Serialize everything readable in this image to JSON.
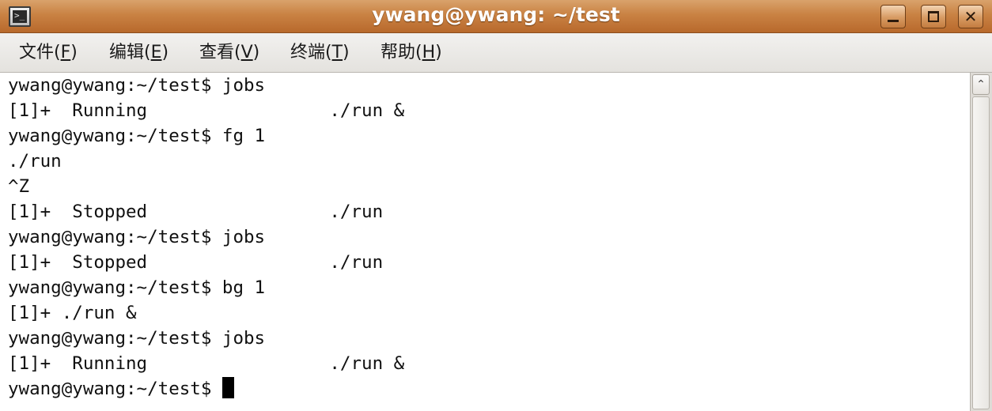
{
  "window": {
    "title": "ywang@ywang: ~/test",
    "icon": "terminal-icon",
    "icon_glyph": ">_",
    "controls": {
      "minimize": "minimize-icon",
      "maximize": "maximize-icon",
      "close": "close-icon",
      "close_glyph": "✕"
    }
  },
  "menu": [
    {
      "label": "文件(",
      "key": "F",
      "tail": ")"
    },
    {
      "label": "编辑(",
      "key": "E",
      "tail": ")"
    },
    {
      "label": "查看(",
      "key": "V",
      "tail": ")"
    },
    {
      "label": "终端(",
      "key": "T",
      "tail": ")"
    },
    {
      "label": "帮助(",
      "key": "H",
      "tail": ")"
    }
  ],
  "terminal": {
    "lines": [
      "ywang@ywang:~/test$ jobs",
      "[1]+  Running                 ./run &",
      "ywang@ywang:~/test$ fg 1",
      "./run",
      "^Z",
      "[1]+  Stopped                 ./run",
      "ywang@ywang:~/test$ jobs",
      "[1]+  Stopped                 ./run",
      "ywang@ywang:~/test$ bg 1",
      "[1]+ ./run &",
      "ywang@ywang:~/test$ jobs",
      "[1]+  Running                 ./run &"
    ],
    "prompt": "ywang@ywang:~/test$ "
  },
  "scrollbar": {
    "up_glyph": "⌃"
  }
}
